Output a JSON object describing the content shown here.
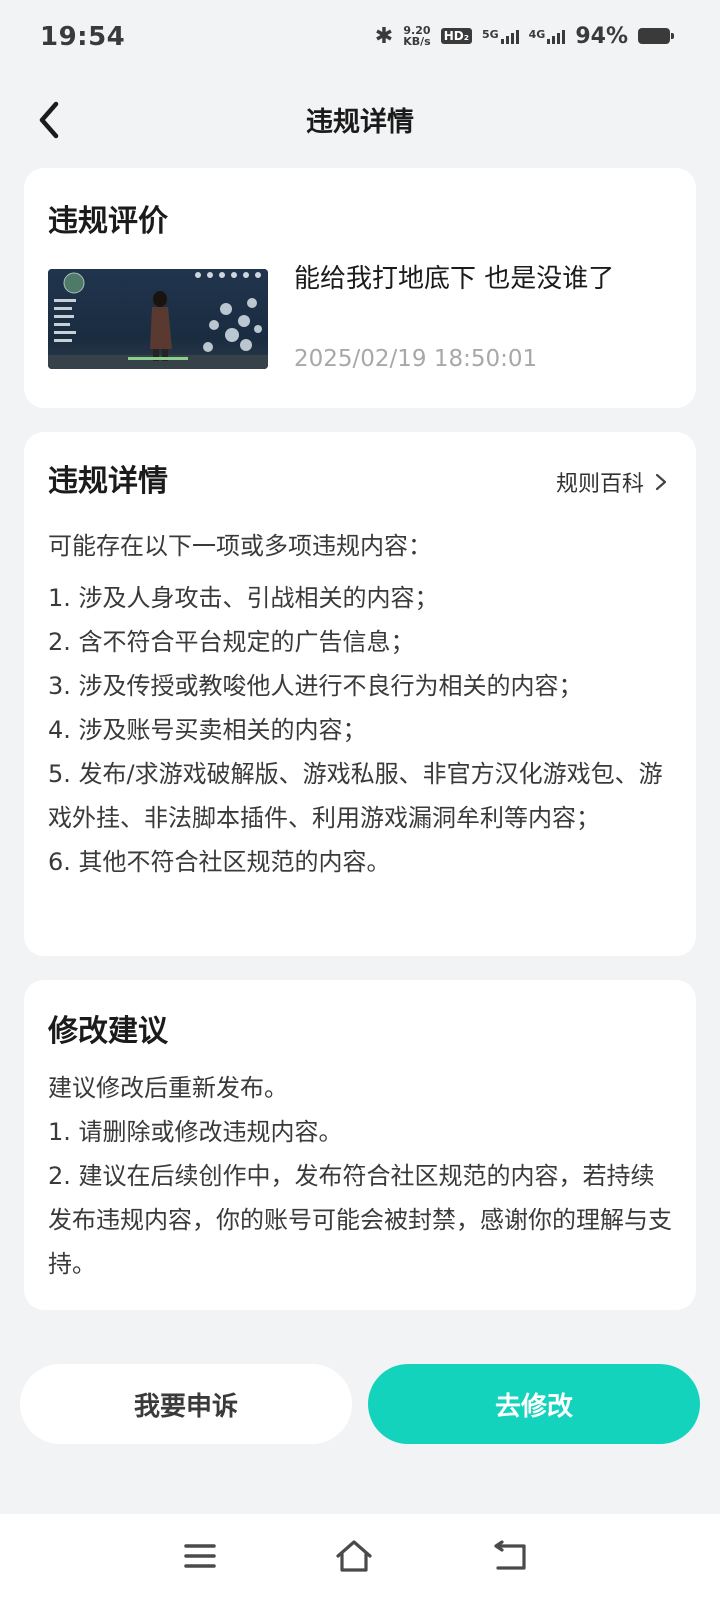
{
  "status_bar": {
    "time": "19:54",
    "net_speed_value": "9.20",
    "net_speed_unit": "KB/s",
    "hd_label": "HD₂",
    "signal1_label": "5G",
    "signal2_label": "4G",
    "battery": "94%"
  },
  "header": {
    "title": "违规详情",
    "back_icon": "chevron-left-icon"
  },
  "review_card": {
    "title": "违规评价",
    "comment": "能给我打地底下 也是没谁了",
    "timestamp": "2025/02/19 18:50:01"
  },
  "detail_card": {
    "title": "违规详情",
    "rules_link": "规则百科",
    "intro": "可能存在以下一项或多项违规内容：",
    "items": [
      "1. 涉及人身攻击、引战相关的内容；",
      "2. 含不符合平台规定的广告信息；",
      "3. 涉及传授或教唆他人进行不良行为相关的内容；",
      "4. 涉及账号买卖相关的内容；",
      "5. 发布/求游戏破解版、游戏私服、非官方汉化游戏包、游戏外挂、非法脚本插件、利用游戏漏洞牟利等内容；",
      "6. 其他不符合社区规范的内容。"
    ]
  },
  "suggest_card": {
    "title": "修改建议",
    "intro": "建议修改后重新发布。",
    "items": [
      "1. 请删除或修改违规内容。",
      "2. 建议在后续创作中，发布符合社区规范的内容，若持续发布违规内容，你的账号可能会被封禁，感谢你的理解与支持。"
    ]
  },
  "actions": {
    "appeal": "我要申诉",
    "modify": "去修改"
  },
  "colors": {
    "accent": "#14d3bd",
    "background": "#f2f3f5",
    "card": "#ffffff",
    "secondary_text": "#a8a8a8"
  }
}
